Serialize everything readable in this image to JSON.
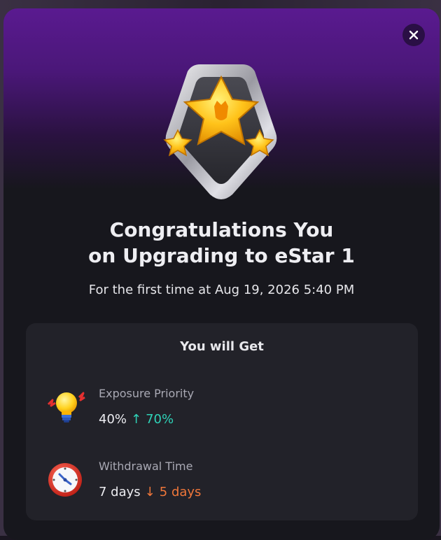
{
  "modal": {
    "title_line1": "Congratulations You",
    "title_line2": "on Upgrading to eStar 1",
    "subtitle": "For the first time at Aug 19, 2026 5:40 PM",
    "close_icon": "close-icon",
    "badge_icon": "star-badge-icon"
  },
  "benefits": {
    "title": "You will Get",
    "items": [
      {
        "icon": "lightbulb-icon",
        "label": "Exposure Priority",
        "old_value": "40%",
        "arrow": "↑",
        "new_value": "70%",
        "direction": "up"
      },
      {
        "icon": "clock-icon",
        "label": "Withdrawal Time",
        "old_value": "7 days",
        "arrow": "↓",
        "new_value": "5 days",
        "direction": "down"
      }
    ]
  },
  "colors": {
    "increase": "#2fd3b8",
    "decrease": "#f0773a",
    "header_purple": "#5a1a90",
    "panel_bg": "#222229"
  }
}
